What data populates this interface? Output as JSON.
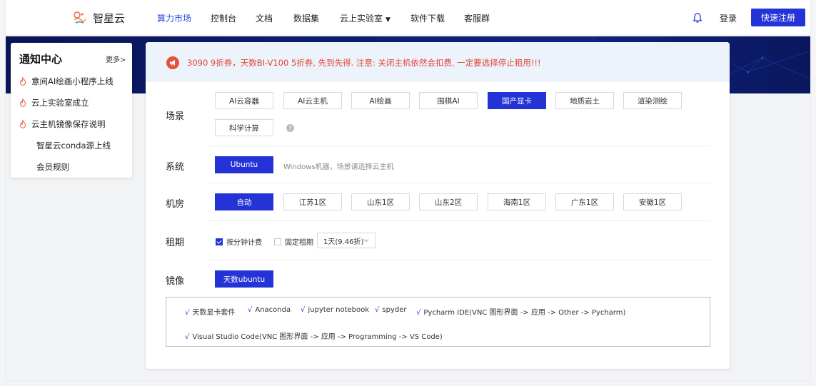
{
  "brand": {
    "name": "智星云"
  },
  "nav": {
    "items": [
      {
        "label": "算力市场",
        "active": true
      },
      {
        "label": "控制台"
      },
      {
        "label": "文档"
      },
      {
        "label": "数据集"
      },
      {
        "label": "云上实验室"
      },
      {
        "label": "软件下载"
      },
      {
        "label": "客服群"
      }
    ],
    "dropdown_caret": "▼",
    "login": "登录",
    "signup": "快速注册"
  },
  "notice": {
    "title": "通知中心",
    "more": "更多>",
    "items": [
      {
        "label": "意间AI绘画小程序上线",
        "hot": true
      },
      {
        "label": "云上实验室成立",
        "hot": true
      },
      {
        "label": "云主机镜像保存说明",
        "hot": true
      },
      {
        "label": "智星云conda源上线",
        "hot": false
      },
      {
        "label": "会员规则",
        "hot": false
      }
    ]
  },
  "alert": {
    "text": "3090 9折券，天数BI-V100 5折券, 先到先得. 注意: 关闭主机依然会扣费, 一定要选择停止租用!!!"
  },
  "filters": {
    "scene": {
      "label": "场景",
      "options": [
        "AI云容器",
        "AI云主机",
        "AI绘画",
        "围棋AI",
        "国产显卡",
        "地质岩土",
        "渲染测绘",
        "科学计算"
      ],
      "selected": "国产显卡",
      "help": "?"
    },
    "system": {
      "label": "系统",
      "options": [
        "Ubuntu"
      ],
      "selected": "Ubuntu",
      "hint": "Windows机器，场景请选择云主机"
    },
    "room": {
      "label": "机房",
      "options": [
        "自动",
        "江苏1区",
        "山东1区",
        "山东2区",
        "海南1区",
        "广东1区",
        "安徽1区"
      ],
      "selected": "自动"
    },
    "rent": {
      "label": "租期",
      "per_minute": "按分钟计费",
      "per_minute_checked": true,
      "fixed": "固定租期",
      "fixed_checked": false,
      "fixed_value": "1天(9.46折)"
    },
    "image": {
      "label": "镜像",
      "options": [
        "天数ubuntu"
      ],
      "selected": "天数ubuntu"
    }
  },
  "software": {
    "tick": "√",
    "items": [
      "天数显卡套件",
      "Anaconda",
      "jupyter notebook",
      "spyder",
      "Pycharm IDE(VNC 图形界面 -> 应用 -> Other -> Pycharm)",
      "Visual Studio Code(VNC 图形界面 -> 应用 -> Programming -> VS Code)"
    ]
  },
  "colors": {
    "accent": "#2433d6",
    "nav_active": "#2b4ae6",
    "alert_text": "#e0443a",
    "alert_bg": "#edf3fb",
    "banner": "#0d1d6e",
    "hot_icon": "#e8643c"
  }
}
